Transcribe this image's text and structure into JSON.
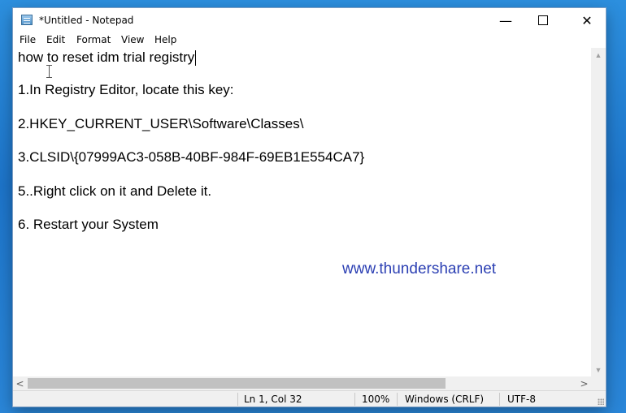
{
  "window": {
    "title": "*Untitled - Notepad",
    "controls": {
      "minimize": "—",
      "close": "✕"
    }
  },
  "menu": [
    "File",
    "Edit",
    "Format",
    "View",
    "Help"
  ],
  "editor": {
    "lines": [
      "how to reset idm trial registry",
      "1.In Registry Editor, locate this key:",
      "2.HKEY_CURRENT_USER\\Software\\Classes\\",
      "3.CLSID\\{07999AC3-058B-40BF-984F-69EB1E554CA7}",
      "5..Right click on it and Delete it.",
      "6. Restart your System"
    ],
    "watermark": "www.thundershare.net"
  },
  "scrollbars": {
    "up": "▲",
    "down": "▼",
    "left": "<",
    "right": ">"
  },
  "status": {
    "position": "Ln 1, Col 32",
    "zoom": "100%",
    "line_ending": "Windows (CRLF)",
    "encoding": "UTF-8"
  },
  "icons": [
    "notepad-app-icon",
    "text-cursor-icon",
    "resize-grip-icon"
  ]
}
